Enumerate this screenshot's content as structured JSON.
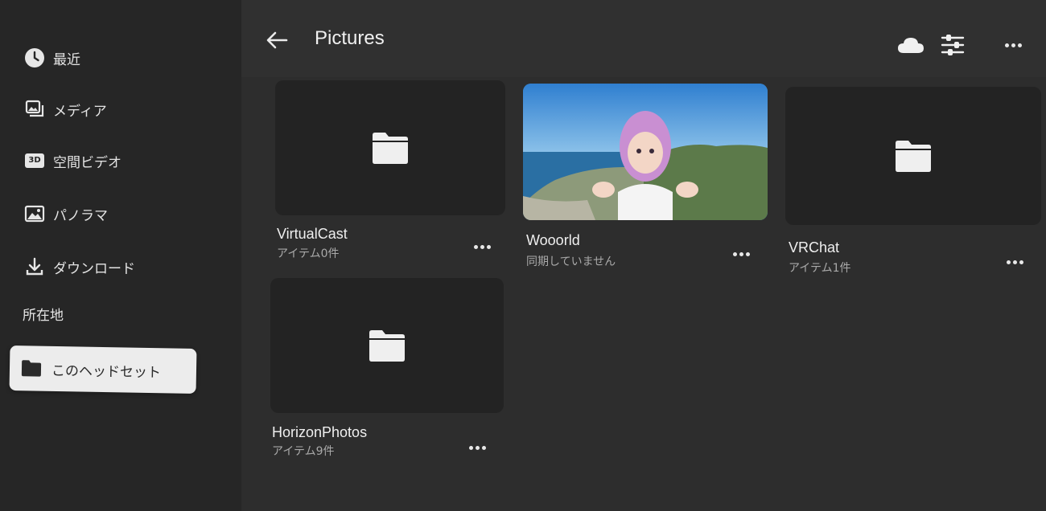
{
  "sidebar": {
    "items": [
      {
        "label": "最近",
        "icon": "clock-icon"
      },
      {
        "label": "メディア",
        "icon": "media-icon"
      },
      {
        "label": "空間ビデオ",
        "icon": "3d-icon",
        "badge": "3D"
      },
      {
        "label": "パノラマ",
        "icon": "panorama-icon"
      },
      {
        "label": "ダウンロード",
        "icon": "download-icon"
      }
    ],
    "section_label": "所在地",
    "location": {
      "label": "このヘッドセット",
      "icon": "folder-icon"
    }
  },
  "header": {
    "title": "Pictures",
    "icons": [
      "back-arrow-icon",
      "cloud-icon",
      "filter-sliders-icon",
      "more-icon"
    ]
  },
  "folders": [
    {
      "name": "VirtualCast",
      "sub": "アイテム0件",
      "type": "folder"
    },
    {
      "name": "Wooorld",
      "sub": "同期していません",
      "type": "photo"
    },
    {
      "name": "VRChat",
      "sub": "アイテム1件",
      "type": "folder"
    },
    {
      "name": "HorizonPhotos",
      "sub": "アイテム9件",
      "type": "folder"
    }
  ],
  "colors": {
    "background": "#2c2c2c",
    "sidebar": "#262626",
    "tile": "#232323",
    "selected": "#ececec"
  }
}
